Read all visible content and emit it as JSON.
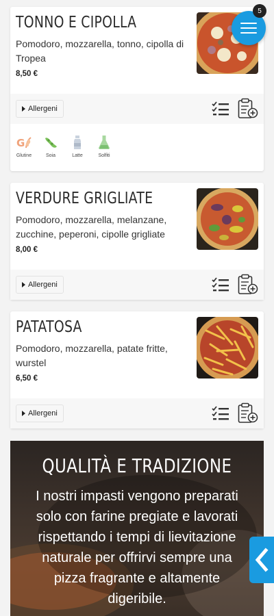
{
  "menu_badge_count": "5",
  "allergens_button_label": "Allergeni",
  "items": [
    {
      "title": "TONNO E CIPOLLA",
      "description": "Pomodoro, mozzarella, tonno, cipolla di Tropea",
      "price": "8,50 €"
    },
    {
      "title": "VERDURE GRIGLIATE",
      "description": "Pomodoro, mozzarella, melanzane, zucchine, peperoni, cipolle grigliate",
      "price": "8,00 €"
    },
    {
      "title": "PATATOSA",
      "description": "Pomodoro, mozzarella, patate fritte, wurstel",
      "price": "6,50 €"
    }
  ],
  "allergens": [
    {
      "label": "Glutine",
      "icon": "gluten-icon"
    },
    {
      "label": "Soia",
      "icon": "soy-icon"
    },
    {
      "label": "Latte",
      "icon": "milk-icon"
    },
    {
      "label": "Solfiti",
      "icon": "sulfites-icon"
    }
  ],
  "promo": {
    "title": "QUALITÀ E TRADIZIONE",
    "text": "I nostri impasti vengono preparati solo con farine pregiate e lavorati rispettando i tempi di lievitazione naturale per offrirvi sempre una pizza fragrante e altamente digeribile."
  },
  "colors": {
    "accent": "#1a9be0",
    "card_bar": "#f7f7f7"
  }
}
